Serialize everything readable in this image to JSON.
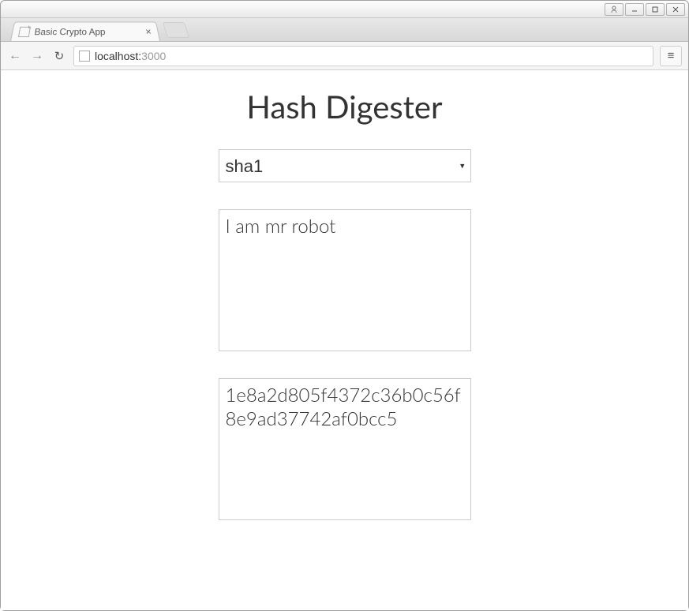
{
  "window": {
    "tab_title": "Basic Crypto App"
  },
  "url": {
    "host": "localhost:",
    "port": "3000"
  },
  "page": {
    "heading": "Hash Digester",
    "algo_selected": "sha1",
    "input_text": "I am mr robot",
    "output_hash": "1e8a2d805f4372c36b0c56f8e9ad37742af0bcc5"
  }
}
